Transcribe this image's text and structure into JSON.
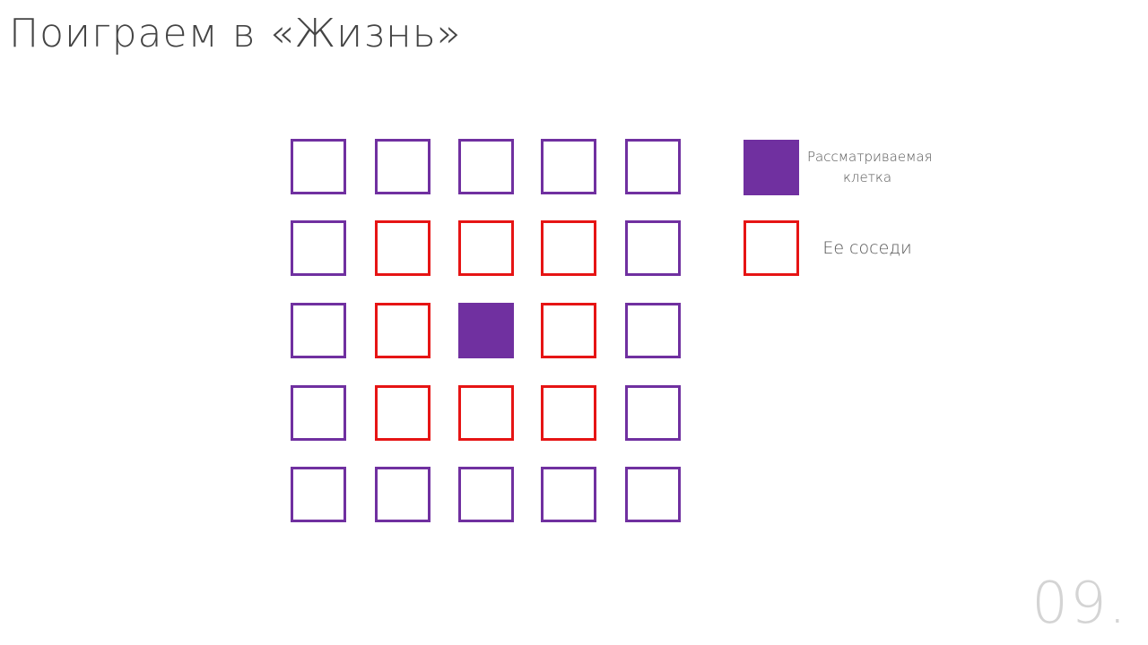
{
  "slide": {
    "title": "Поиграем в «Жизнь»",
    "page_number": "09."
  },
  "grid": {
    "rows": 5,
    "cols": 5,
    "current_cell": [
      2,
      2
    ],
    "neighbors": [
      [
        1,
        1
      ],
      [
        1,
        2
      ],
      [
        1,
        3
      ],
      [
        2,
        1
      ],
      [
        2,
        3
      ],
      [
        3,
        1
      ],
      [
        3,
        2
      ],
      [
        3,
        3
      ]
    ]
  },
  "legend": {
    "current_label": "Рассматриваемая клетка",
    "neighbors_label": "Ее соседи"
  },
  "colors": {
    "cell_border": "#7030a0",
    "current_fill": "#7030a0",
    "neighbor_border": "#e61414",
    "title_text": "#444444",
    "page_number": "#d4d4d4"
  }
}
